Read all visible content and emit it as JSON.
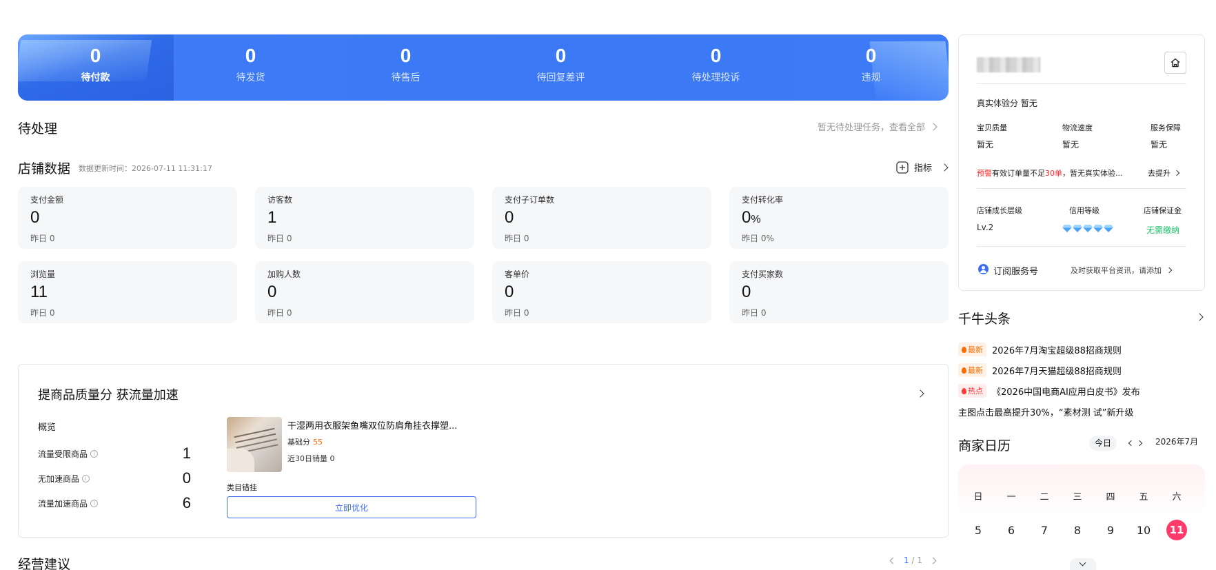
{
  "status_bar": [
    {
      "count": "0",
      "label": "待付款"
    },
    {
      "count": "0",
      "label": "待发货"
    },
    {
      "count": "0",
      "label": "待售后"
    },
    {
      "count": "0",
      "label": "待回复差评"
    },
    {
      "count": "0",
      "label": "待处理投诉"
    },
    {
      "count": "0",
      "label": "违规"
    }
  ],
  "todo": {
    "title": "待处理",
    "link": "暂无待处理任务，查看全部"
  },
  "shop_data": {
    "title": "店铺数据",
    "updated": "数据更新时间：2026-07-11 11:31:17",
    "metrics_link": "指标",
    "metrics": [
      {
        "label": "支付金额",
        "value": "0",
        "unit": "",
        "sub": "昨日 0"
      },
      {
        "label": "访客数",
        "value": "1",
        "unit": "",
        "sub": "昨日 0"
      },
      {
        "label": "支付子订单数",
        "value": "0",
        "unit": "",
        "sub": "昨日 0"
      },
      {
        "label": "支付转化率",
        "value": "0",
        "unit": "%",
        "sub": "昨日 0%"
      },
      {
        "label": "浏览量",
        "value": "11",
        "unit": "",
        "sub": "昨日 0"
      },
      {
        "label": "加购人数",
        "value": "0",
        "unit": "",
        "sub": "昨日 0"
      },
      {
        "label": "客单价",
        "value": "0",
        "unit": "",
        "sub": "昨日 0"
      },
      {
        "label": "支付买家数",
        "value": "0",
        "unit": "",
        "sub": "昨日 0"
      }
    ]
  },
  "quality": {
    "title": "提商品质量分 获流量加速",
    "overview": "概览",
    "rows": [
      {
        "label": "流量受限商品",
        "value": "1"
      },
      {
        "label": "无加速商品",
        "value": "0"
      },
      {
        "label": "流量加速商品",
        "value": "6"
      }
    ],
    "product": {
      "name": "干湿两用衣服架鱼嘴双位防肩角挂衣撑塑...",
      "score_label": "基础分",
      "score": "55",
      "sales": "近30日销量 0",
      "category": "类目错挂",
      "button": "立即优化"
    }
  },
  "advice": {
    "title": "经营建议",
    "page_current": "1",
    "page_sep": "/",
    "page_total": "1"
  },
  "side": {
    "experience": "真实体验分  暂无",
    "scores": [
      {
        "label": "宝贝质量",
        "value": "暂无"
      },
      {
        "label": "物流速度",
        "value": "暂无"
      },
      {
        "label": "服务保障",
        "value": "暂无"
      }
    ],
    "warn_tag": "预警",
    "warn_text_1": "有效订单量不足",
    "warn_num": "30单",
    "warn_text_2": "，暂无真实体验...",
    "warn_action": "去提升",
    "levels": [
      {
        "label": "店铺成长层级",
        "value": "Lv.2"
      },
      {
        "label": "信用等级",
        "value": ""
      },
      {
        "label": "店铺保证金",
        "value": "无需缴纳"
      }
    ],
    "subscribe": "订阅服务号",
    "subscribe_hint": "及时获取平台资讯，请添加"
  },
  "news": {
    "title": "千牛头条",
    "items": [
      {
        "tag": "最新",
        "tag_type": "new",
        "text": "2026年7月淘宝超级88招商规则"
      },
      {
        "tag": "最新",
        "tag_type": "new",
        "text": "2026年7月天猫超级88招商规则"
      },
      {
        "tag": "热点",
        "tag_type": "hot",
        "text": "《2026中国电商AI应用白皮书》发布"
      },
      {
        "tag": "",
        "tag_type": "",
        "text": "主图点击最高提升30%，“素材测 试”新升级"
      }
    ]
  },
  "calendar": {
    "title": "商家日历",
    "today_btn": "今日",
    "month": "2026年7月",
    "weekdays": [
      "日",
      "一",
      "二",
      "三",
      "四",
      "五",
      "六"
    ],
    "days": [
      "5",
      "6",
      "7",
      "8",
      "9",
      "10",
      "11"
    ],
    "today": "11"
  },
  "colors": {
    "primary": "#3d6ef5",
    "banner": "#3f7cf6",
    "warn": "#ff2a2a",
    "success": "#1fc36b",
    "today": "#ff3b6b"
  }
}
